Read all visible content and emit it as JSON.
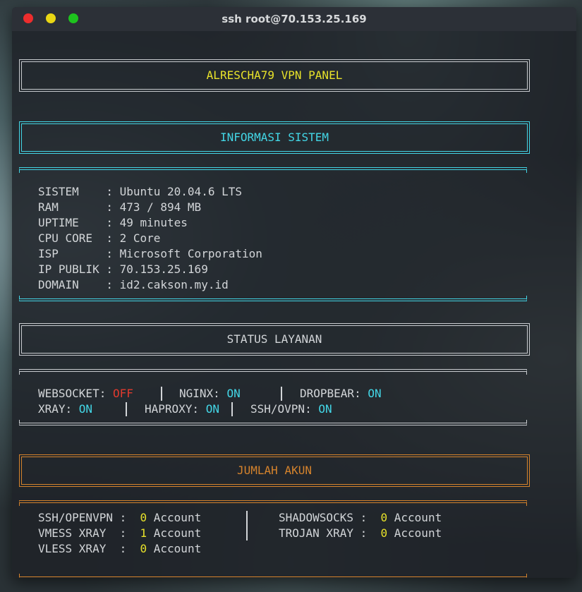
{
  "window": {
    "title": "ssh root@70.153.25.169"
  },
  "colors": {
    "cyan": "#43d6e6",
    "yellow": "#e8e22a",
    "red": "#e13a2e",
    "orange": "#d5832c",
    "border_white": "#c9ccd0"
  },
  "panel": {
    "title": "ALRESCHA79 VPN PANEL"
  },
  "sysinfo": {
    "header": "INFORMASI SISTEM",
    "rows": [
      {
        "label": "SISTEM    ",
        "sep": ": ",
        "value": "Ubuntu 20.04.6 LTS"
      },
      {
        "label": "RAM       ",
        "sep": ": ",
        "value": "473 / 894 MB"
      },
      {
        "label": "UPTIME    ",
        "sep": ": ",
        "value": "49 minutes"
      },
      {
        "label": "CPU CORE  ",
        "sep": ": ",
        "value": "2 Core"
      },
      {
        "label": "ISP       ",
        "sep": ": ",
        "value": "Microsoft Corporation"
      },
      {
        "label": "IP PUBLIK ",
        "sep": ": ",
        "value": "70.153.25.169"
      },
      {
        "label": "DOMAIN    ",
        "sep": ": ",
        "value": "id2.cakson.my.id"
      }
    ]
  },
  "services": {
    "header": "STATUS LAYANAN",
    "websocket": {
      "label": "WEBSOCKET: ",
      "status": "OFF"
    },
    "nginx": {
      "label": "NGINX: ",
      "status": "ON"
    },
    "dropbear": {
      "label": "DROPBEAR: ",
      "status": "ON"
    },
    "xray": {
      "label": "XRAY: ",
      "status": "ON"
    },
    "haproxy": {
      "label": "HAPROXY: ",
      "status": "ON"
    },
    "sshovpn": {
      "label": "SSH/OVPN: ",
      "status": "ON"
    }
  },
  "accounts": {
    "header": "JUMLAH AKUN",
    "ssh": {
      "label": "SSH/OPENVPN :  ",
      "count": "0",
      "unit": " Account"
    },
    "vmess": {
      "label": "VMESS XRAY  :  ",
      "count": "1",
      "unit": " Account"
    },
    "vless": {
      "label": "VLESS XRAY  :  ",
      "count": "0",
      "unit": " Account"
    },
    "shadowsocks": {
      "label": "SHADOWSOCKS :  ",
      "count": "0",
      "unit": " Account"
    },
    "trojan": {
      "label": "TROJAN XRAY :  ",
      "count": "0",
      "unit": " Account"
    }
  }
}
